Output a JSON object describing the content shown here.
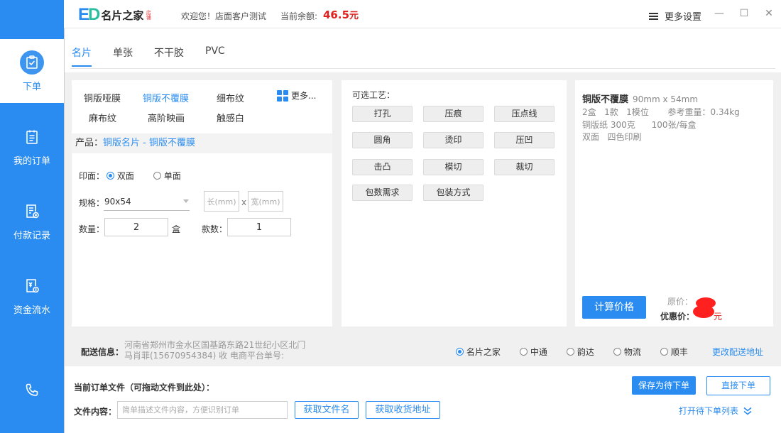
{
  "brand": {
    "mark": "ED",
    "name": "名片之家",
    "tag": "店铺"
  },
  "header": {
    "welcome": "欢迎您！店面客户测试",
    "balance_label": "当前余额:",
    "balance_value": "46.5",
    "balance_unit": "元",
    "more_settings": "更多设置",
    "minimize": "—",
    "maximize": "☐",
    "close": "✕"
  },
  "sidebar": {
    "items": [
      {
        "label": "下单",
        "icon": "clipboard-check-icon"
      },
      {
        "label": "我的订单",
        "icon": "list-document-icon"
      },
      {
        "label": "付款记录",
        "icon": "payment-record-icon"
      },
      {
        "label": "资金流水",
        "icon": "fund-flow-icon"
      },
      {
        "label": "",
        "icon": "phone-icon"
      }
    ]
  },
  "tabs": [
    "名片",
    "单张",
    "不干胶",
    "PVC"
  ],
  "subcategories": {
    "row1": [
      "铜版哑膜",
      "铜版不覆膜",
      "细布纹"
    ],
    "row2": [
      "麻布纹",
      "高阶映画",
      "触感白"
    ],
    "more": "更多..."
  },
  "product": {
    "label": "产品：",
    "value": "铜版名片 - 铜版不覆膜"
  },
  "print": {
    "label": "印面：",
    "options": [
      "双面",
      "单面"
    ]
  },
  "spec": {
    "label": "规格：",
    "value": "90x54",
    "length_placeholder": "长(mm)",
    "times": "x",
    "width_placeholder": "宽(mm)"
  },
  "quantity": {
    "label": "数量：",
    "value": "2",
    "unit": "盒",
    "styles_label": "款数：",
    "styles_value": "1"
  },
  "process": {
    "label": "可选工艺：",
    "buttons": [
      "打孔",
      "压痕",
      "压点线",
      "圆角",
      "烫印",
      "压凹",
      "击凸",
      "模切",
      "裁切",
      "包数需求",
      "包装方式"
    ]
  },
  "summary": {
    "title": "铜版不覆膜",
    "size": "90mm x 54mm",
    "line1": "2盒   1款   1模位       参考重量：0.34kg",
    "line2": "铜版纸 300克      100张/每盒",
    "line3": "双面   四色印刷",
    "calc_button": "计算价格",
    "orig_label": "原价：",
    "discount_label": "优惠价：",
    "discount_unit": "元"
  },
  "shipping": {
    "label": "配送信息：",
    "address_line1": "河南省郑州市金水区国基路东路21世纪小区北门",
    "address_line2": "马肖菲(15670954384) 收   电商平台单号:",
    "couriers": [
      "名片之家",
      "中通",
      "韵达",
      "物流",
      "顺丰"
    ],
    "change_link": "更改配送地址"
  },
  "order": {
    "title": "当前订单文件（可拖动文件到此处）：",
    "save_button": "保存为待下单",
    "direct_button": "直接下单",
    "file_label": "文件内容：",
    "file_placeholder": "简单描述文件内容，方便识别订单",
    "get_filename": "获取文件名",
    "get_address": "获取收货地址",
    "open_list": "打开待下单列表"
  },
  "colors": {
    "accent": "#2a8cf0",
    "price": "#e02020",
    "brand_green": "#2dbd9f"
  }
}
